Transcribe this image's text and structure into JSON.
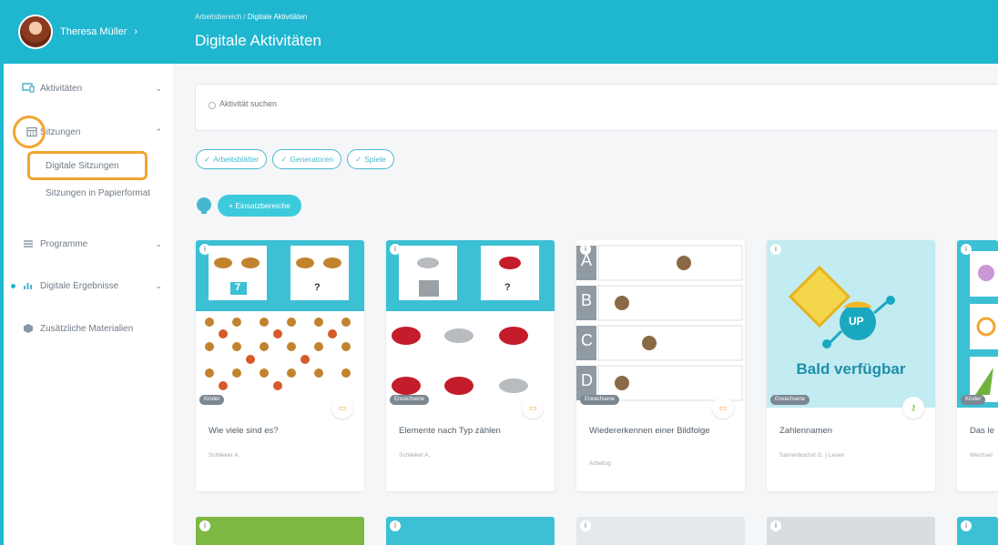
{
  "user": {
    "name": "Theresa Müller",
    "chevron": "›"
  },
  "nav": {
    "aktivitaeten": "Aktivitäten",
    "sitzungen": "Sitzungen",
    "digitale_sitzungen": "Digitale Sitzungen",
    "sitzungen_papier": "Sitzungen in Papierformat",
    "programme": "Programme",
    "digitale_ergebnisse": "Digitale Ergebnisse",
    "zusaetzliche": "Zusätzliche Materialien",
    "chev_down": "⌄",
    "chev_up": "⌃"
  },
  "header": {
    "breadcrumb_root": "Arbeitsbereich",
    "breadcrumb_sep": "/",
    "breadcrumb_current": "Digitale Aktivitäten",
    "title": "Digitale Aktivitäten"
  },
  "search": {
    "placeholder": "Aktivität suchen"
  },
  "chips": [
    "Arbeitsblätter",
    "Generatoren",
    "Spiele"
  ],
  "chip_check": "✓",
  "bereiche_button": "+ Einsatzbereiche",
  "cards": [
    {
      "title": "Wie viele sind es?",
      "author": "Schlieker A.",
      "badge": "Kinder"
    },
    {
      "title": "Elemente nach Typ zählen",
      "author": "Schlieker A.",
      "badge": "Erwachsene"
    },
    {
      "title": "Wiedererkennen einer Bildfolge",
      "author": "Arbeitsg",
      "badge": "Erwachsene"
    },
    {
      "title": "Zahlennamen",
      "author": "Samenbochst G. | Lesen",
      "badge": "Erwachsene",
      "overlay": "Bald verfügbar",
      "logo": "UP"
    },
    {
      "title": "Das le",
      "author": "Wechsel",
      "badge": "Kinder"
    }
  ],
  "card2_labels": {
    "top_num": "7",
    "top_q": "?",
    "mid_q": "?"
  },
  "card3_letters": [
    "A",
    "B",
    "C",
    "D"
  ],
  "colors": {
    "accent": "#1fb6d0",
    "highlight": "#f2a52f"
  },
  "icons": {
    "info": "i",
    "calendar": "▭",
    "key": "⚷"
  }
}
